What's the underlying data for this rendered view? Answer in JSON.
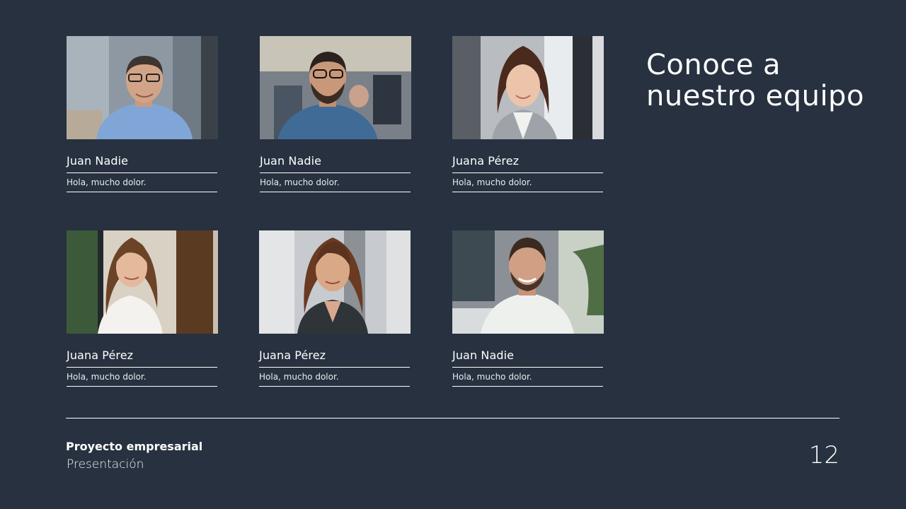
{
  "heading": {
    "line1": "Conoce a",
    "line2": "nuestro equipo"
  },
  "team": [
    {
      "name": "Juan Nadie",
      "description": "Hola, mucho dolor.",
      "photo": "man-glasses-office-photo"
    },
    {
      "name": "Juan Nadie",
      "description": "Hola, mucho dolor.",
      "photo": "man-beard-glasses-denim-photo"
    },
    {
      "name": "Juana Pérez",
      "description": "Hola, mucho dolor.",
      "photo": "woman-long-hair-blazer-photo"
    },
    {
      "name": "Juana Pérez",
      "description": "Hola, mucho dolor.",
      "photo": "woman-white-blouse-photo"
    },
    {
      "name": "Juana Pérez",
      "description": "Hola, mucho dolor.",
      "photo": "woman-dark-blazer-photo"
    },
    {
      "name": "Juan Nadie",
      "description": "Hola, mucho dolor.",
      "photo": "man-smiling-white-shirt-photo"
    }
  ],
  "footer": {
    "title": "Proyecto empresarial",
    "subtitle": "Presentación",
    "page_number": "12"
  },
  "colors": {
    "background": "#27313f",
    "text": "#ffffff"
  }
}
